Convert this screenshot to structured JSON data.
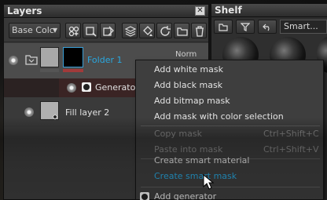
{
  "layers_panel": {
    "title": "Layers",
    "close_label": "✕",
    "blend_mode": "Base Colc",
    "toolbar_icons": [
      "add-layer-icon",
      "add-filter-icon",
      "mask-icon",
      "paint-icon",
      "stack-icon",
      "fill-icon",
      "refresh-icon",
      "folder-add-icon",
      "trash-icon"
    ]
  },
  "layers": [
    {
      "name": "Folder 1",
      "opacity_text": "Norm",
      "selected": true
    },
    {
      "name": "Generato",
      "selected": false
    },
    {
      "name": "Fill layer 2",
      "selected": false
    }
  ],
  "shelf": {
    "title": "Shelf",
    "tab_label": "Smart..."
  },
  "context_menu": {
    "items": [
      {
        "label": "Add white mask",
        "shortcut": "",
        "state": "normal"
      },
      {
        "label": "Add black mask",
        "shortcut": "",
        "state": "normal"
      },
      {
        "label": "Add bitmap mask",
        "shortcut": "",
        "state": "normal"
      },
      {
        "label": "Add mask with color selection",
        "shortcut": "",
        "state": "normal"
      },
      {
        "label": "Copy mask",
        "shortcut": "Ctrl+Shift+C",
        "state": "disabled"
      },
      {
        "label": "Paste into mask",
        "shortcut": "Ctrl+Shift+V",
        "state": "disabled"
      },
      {
        "label": "Create smart material",
        "shortcut": "",
        "state": "normal"
      },
      {
        "label": "Create smart mask",
        "shortcut": "",
        "state": "highlight"
      },
      {
        "label": "Add generator",
        "shortcut": "",
        "state": "normal"
      }
    ]
  },
  "colors": {
    "accent": "#29a8e0",
    "panel_bg": "#3c3c3c",
    "menu_bg": "#3e3e3e",
    "disabled_text": "#8a8a8a",
    "mask_red": "#a23a3a"
  }
}
